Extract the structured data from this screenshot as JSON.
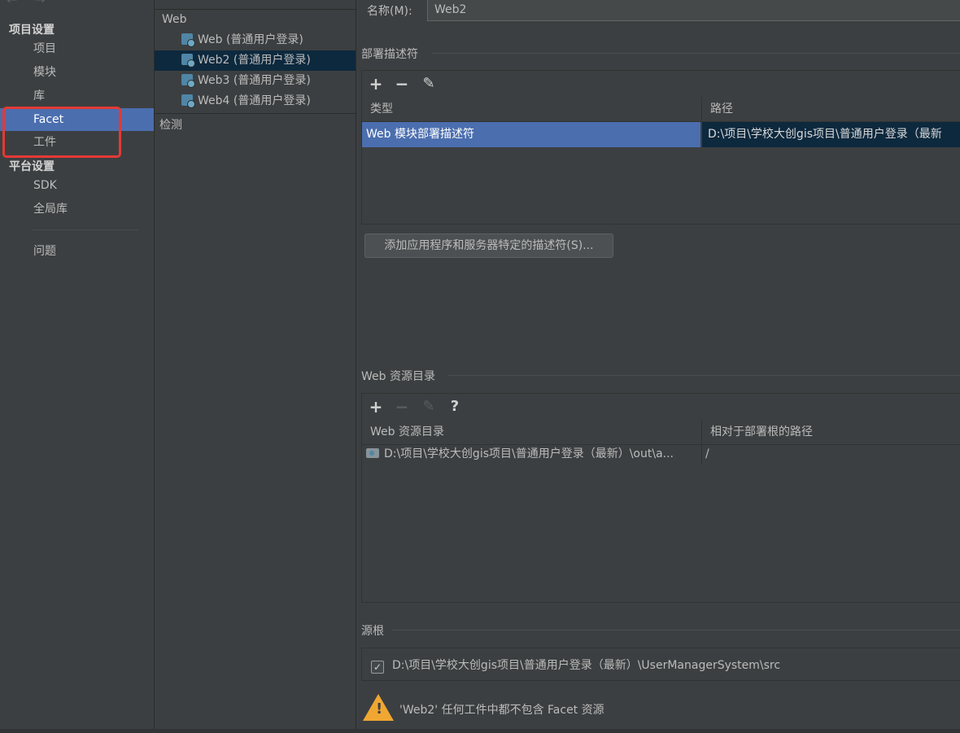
{
  "sidebar": {
    "nav_glyph": "← →",
    "project_settings_title": "项目设置",
    "project_items": [
      "项目",
      "模块",
      "库",
      "Facet",
      "工件"
    ],
    "platform_settings_title": "平台设置",
    "platform_items": [
      "SDK",
      "全局库"
    ],
    "problems_label": "问题",
    "selected_item": "Facet"
  },
  "tree": {
    "root_label": "Web",
    "items": [
      "Web (普通用户登录)",
      "Web2 (普通用户登录)",
      "Web3 (普通用户登录)",
      "Web4 (普通用户登录)"
    ],
    "selected_item": "Web2 (普通用户登录)",
    "detect_label": "检测",
    "item_icon": "web-facet-icon"
  },
  "main": {
    "name_label": "名称(M):",
    "name_value": "Web2",
    "deploy_descriptors": {
      "title": "部署描述符",
      "toolbar": [
        "+",
        "−",
        "✎"
      ],
      "columns": [
        "类型",
        "路径"
      ],
      "rows": [
        {
          "type": "Web 模块部署描述符",
          "path": "D:\\项目\\学校大创gis项目\\普通用户登录（最新"
        }
      ],
      "add_button_label": "添加应用程序和服务器特定的描述符(S)..."
    },
    "web_resources": {
      "title": "Web 资源目录",
      "toolbar": [
        "+",
        "−",
        "✎",
        "?"
      ],
      "columns": [
        "Web 资源目录",
        "相对于部署根的路径"
      ],
      "rows": [
        {
          "directory": "D:\\项目\\学校大创gis项目\\普通用户登录（最新）\\out\\a...",
          "relative_path": "/"
        }
      ]
    },
    "source_roots": {
      "title": "源根",
      "checkbox_checked": true,
      "check_mark": "✓",
      "path": "D:\\项目\\学校大创gis项目\\普通用户登录（最新）\\UserManagerSystem\\src"
    },
    "warning": {
      "icon": "warning-icon",
      "mark": "!",
      "text": "'Web2' 任何工件中都不包含 Facet 资源"
    }
  },
  "colors": {
    "background": "#3c3f41",
    "selection_active": "#4b6eaf",
    "selection_inactive": "#0d293e",
    "highlight_box": "#e53935",
    "warning": "#f0a732"
  }
}
